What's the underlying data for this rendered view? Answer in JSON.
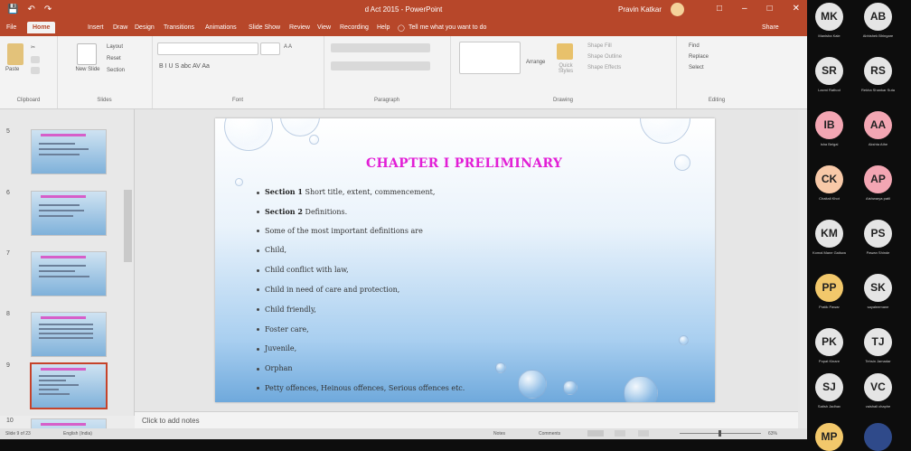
{
  "app": {
    "document_title": "d Act 2015 - PowerPoint",
    "user_name": "Pravin Katkar",
    "share_label": "Share",
    "tell_me": "Tell me what you want to do"
  },
  "tabs": [
    "File",
    "Home",
    "Insert",
    "Draw",
    "Design",
    "Transitions",
    "Animations",
    "Slide Show",
    "Review",
    "View",
    "Recording",
    "Help"
  ],
  "ribbon": {
    "clipboard": {
      "paste": "Paste",
      "label": "Clipboard"
    },
    "slides": {
      "new_slide": "New Slide",
      "layout": "Layout",
      "reset": "Reset",
      "section": "Section",
      "label": "Slides"
    },
    "font": {
      "label": "Font",
      "format_row": "B  I  U  S  abc  AV  Aa",
      "size_row": "A  A"
    },
    "paragraph": {
      "label": "Paragraph"
    },
    "drawing": {
      "arrange": "Arrange",
      "quick_styles": "Quick Styles",
      "shape_fill": "Shape Fill",
      "shape_outline": "Shape Outline",
      "shape_effects": "Shape Effects",
      "label": "Drawing"
    },
    "editing": {
      "find": "Find",
      "replace": "Replace",
      "select": "Select",
      "label": "Editing"
    }
  },
  "thumbnails": [
    {
      "num": "5",
      "selected": false
    },
    {
      "num": "6",
      "selected": false
    },
    {
      "num": "7",
      "selected": false
    },
    {
      "num": "8",
      "selected": false
    },
    {
      "num": "9",
      "selected": true
    },
    {
      "num": "10",
      "selected": false
    }
  ],
  "slide": {
    "title": "CHAPTER I PRELIMINARY",
    "bullets": [
      {
        "bold": "Section 1",
        "text": " Short title, extent, commencement,"
      },
      {
        "bold": "Section 2",
        "text": " Definitions."
      },
      {
        "bold": "",
        "text": "Some of the most important definitions are"
      },
      {
        "bold": "",
        "text": "Child,"
      },
      {
        "bold": "",
        "text": "Child conflict with law,"
      },
      {
        "bold": "",
        "text": "Child in need of care and protection,"
      },
      {
        "bold": "",
        "text": "Child friendly,"
      },
      {
        "bold": "",
        "text": "Foster care,"
      },
      {
        "bold": "",
        "text": "Juvenile,"
      },
      {
        "bold": "",
        "text": "Orphan"
      },
      {
        "bold": "",
        "text": "Petty offences, Heinous offences, Serious offences etc."
      }
    ]
  },
  "notes": {
    "placeholder": "Click to add notes"
  },
  "status": {
    "slide_info": "Slide 9 of 23",
    "language": "English (India)",
    "notes_label": "Notes",
    "comments_label": "Comments",
    "zoom": "63%"
  },
  "participants": [
    {
      "initials": "MK",
      "name": "Manisha Kale",
      "color": "#e5e5e5"
    },
    {
      "initials": "AB",
      "name": "Abhishek Bhingare",
      "color": "#e5e5e5"
    },
    {
      "initials": "SR",
      "name": "Laxmi Rathod",
      "color": "#e5e5e5"
    },
    {
      "initials": "RS",
      "name": "Rekha Shankar Sutar",
      "color": "#e5e5e5"
    },
    {
      "initials": "IB",
      "name": "Isha Belgal",
      "color": "#f3a6b3"
    },
    {
      "initials": "AA",
      "name": "Akshta Athe",
      "color": "#f3a6b3"
    },
    {
      "initials": "CK",
      "name": "Chaitali Khot",
      "color": "#f8c9a8"
    },
    {
      "initials": "AP",
      "name": "Aishwarya patil",
      "color": "#f3a6b3"
    },
    {
      "initials": "KM",
      "name": "Komal Mane Gaikwad",
      "color": "#e5e5e5"
    },
    {
      "initials": "PS",
      "name": "Pawan Shinde",
      "color": "#e5e5e5"
    },
    {
      "initials": "PP",
      "name": "Pratik Pawar",
      "color": "#f2c86b"
    },
    {
      "initials": "SK",
      "name": "sayaleemane",
      "color": "#e5e5e5"
    },
    {
      "initials": "PK",
      "name": "Popat Kinare",
      "color": "#e5e5e5"
    },
    {
      "initials": "TJ",
      "name": "Tehsin Jamadar",
      "color": "#e5e5e5"
    },
    {
      "initials": "SJ",
      "name": "Satish Jadhav",
      "color": "#e5e5e5"
    },
    {
      "initials": "VC",
      "name": "vaishali chaphe",
      "color": "#e5e5e5"
    },
    {
      "initials": "MP",
      "name": "",
      "color": "#f2c86b"
    },
    {
      "initials": "",
      "name": "",
      "color": "#2f4a8a"
    }
  ]
}
